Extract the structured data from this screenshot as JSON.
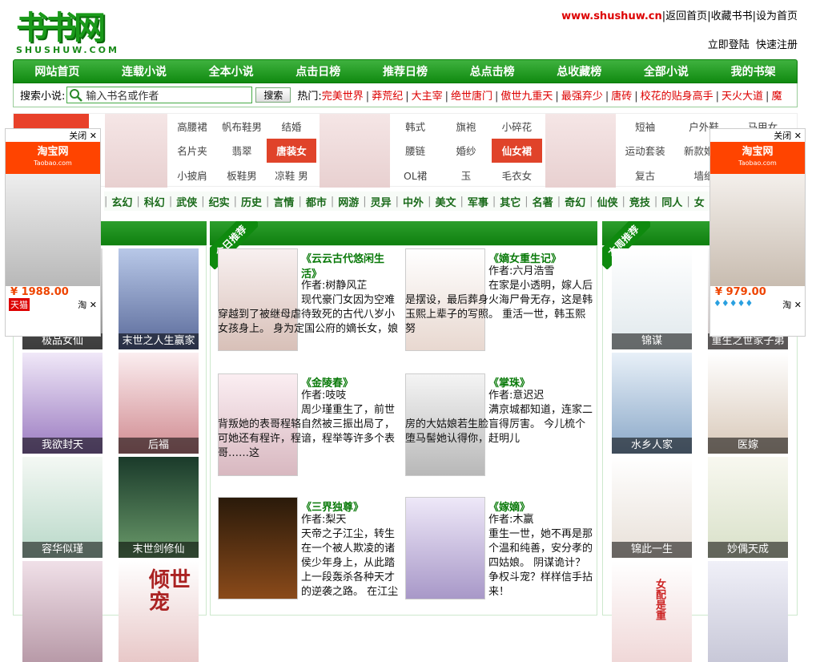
{
  "header": {
    "logo_text": "书书网",
    "logo_sub": "SHUSHUW.COM",
    "site": "www.shushuw.cn",
    "links": [
      "返回首页",
      "收藏书书",
      "设为首页"
    ],
    "login": "立即登陆",
    "register": "快速注册"
  },
  "nav": [
    "网站首页",
    "连载小说",
    "全本小说",
    "点击日榜",
    "推荐日榜",
    "总点击榜",
    "总收藏榜",
    "全部小说",
    "我的书架"
  ],
  "search": {
    "label": "搜索小说:",
    "placeholder": "输入书名或作者",
    "button": "搜索",
    "hot_label": "热门:",
    "hot": [
      "完美世界",
      "莽荒纪",
      "大主宰",
      "绝世唐门",
      "傲世九重天",
      "最强弃少",
      "唐砖",
      "校花的贴身高手",
      "天火大道",
      "魔"
    ]
  },
  "ad_band": {
    "taobao_label": "淘宝网",
    "group1": [
      "高腰裙",
      "帆布鞋男",
      "结婚",
      "名片夹",
      "翡翠",
      "唐装女",
      "小披肩",
      "板鞋男",
      "凉鞋 男"
    ],
    "group2": [
      "韩式",
      "旗袍",
      "小碎花",
      "腰链",
      "婚纱",
      "仙女裙",
      "OL裙",
      "玉",
      "毛衣女"
    ],
    "group3": [
      "短袖",
      "户外鞋",
      "马甲女",
      "运动套装",
      "新款婚纱",
      "",
      "复古",
      "墙纸",
      ""
    ],
    "active": [
      "唐装女",
      "仙女裙"
    ]
  },
  "genres": [
    "玄幻",
    "科幻",
    "武侠",
    "纪实",
    "历史",
    "言情",
    "都市",
    "网游",
    "灵异",
    "中外",
    "美文",
    "军事",
    "其它",
    "名著",
    "奇幻",
    "仙侠",
    "竞技",
    "同人",
    "女"
  ],
  "side_left": {
    "close": "关闭",
    "taobao": "淘宝网",
    "taobao_sub": "Taobao.com",
    "price": "¥ 1988.00",
    "badge": "天猫",
    "tao": "淘"
  },
  "side_right": {
    "close": "关闭",
    "taobao": "淘宝网",
    "taobao_sub": "Taobao.com",
    "price": "¥ 979.00",
    "tao": "淘"
  },
  "left_col": {
    "books": [
      "极品女仙",
      "末世之人生赢家",
      "我欲封天",
      "后福",
      "容华似瑾",
      "末世剑修仙",
      "",
      "倾世宠"
    ]
  },
  "mid_col": {
    "ribbon": "今日推荐",
    "books": [
      {
        "title": "《云云古代悠闲生活》",
        "author": "作者:树静风芷",
        "desc": "现代豪门女因为空难穿越到了被继母虐待致死的古代八岁小女孩身上。 身为定国公府的嫡长女，娘"
      },
      {
        "title": "《嫡女重生记》",
        "author": "作者:六月浩雪",
        "desc": "在家是小透明，嫁人后是摆设，最后葬身火海尸骨无存，这是韩玉熙上辈子的写照。 重活一世，韩玉熙努"
      },
      {
        "title": "《金陵春》",
        "author": "作者:吱吱",
        "desc": "周少瑾重生了，前世背叛她的表哥程辂自然被三振出局了，可她还有程许，程谙，程举等许多个表哥……这"
      },
      {
        "title": "《掌珠》",
        "author": "作者:意迟迟",
        "desc": "满京城都知道，连家二房的大姑娘若生脸盲得厉害。 今儿梳个堕马髻她认得你，赶明儿"
      },
      {
        "title": "《三界独尊》",
        "author": "作者:梨天",
        "desc": "天帝之子江尘，转生在一个被人欺凌的诸侯少年身上，从此踏上一段轰杀各种天才的逆袭之路。 在江尘"
      },
      {
        "title": "《嫁嫡》",
        "author": "作者:木嬴",
        "desc": "重生一世，她不再是那个温和纯善，安分孝的四姑娘。 阴谋诡计？争权斗宠？样样信手拈来！"
      }
    ]
  },
  "right_col": {
    "ribbon": "本周推荐",
    "books": [
      "锦谋",
      "重生之世家子弟",
      "水乡人家",
      "医嫁",
      "锦此一生",
      "妙偶天成",
      "女配是重",
      ""
    ]
  }
}
